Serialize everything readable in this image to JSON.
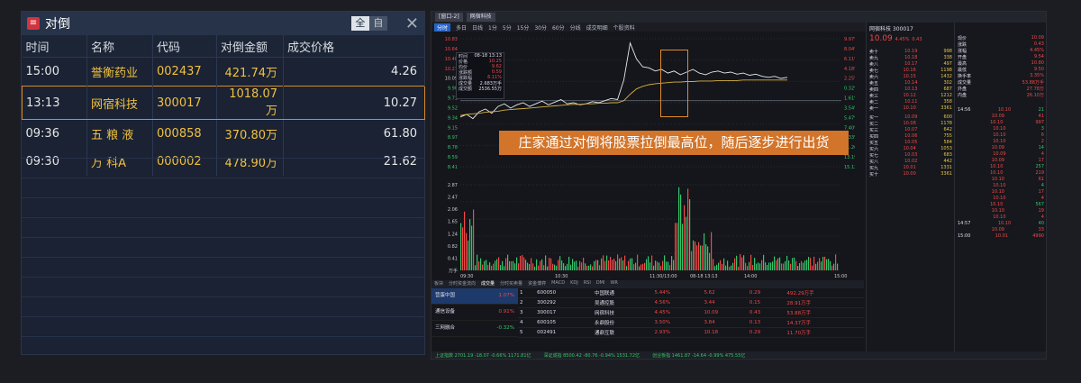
{
  "left_panel": {
    "title": "对倒",
    "logo_glyph": "≡",
    "toggle_all": "全",
    "toggle_self": "自",
    "close_glyph": "✕",
    "columns": [
      "时间",
      "名称",
      "代码",
      "对倒金额",
      "成交价格"
    ],
    "rows": [
      {
        "time": "15:00",
        "name": "誉衡药业",
        "code": "002437",
        "amount": "421.74万",
        "price": "4.26"
      },
      {
        "time": "13:13",
        "name": "网宿科技",
        "code": "300017",
        "amount": "1018.07万",
        "price": "10.27"
      },
      {
        "time": "09:36",
        "name": "五 粮 液",
        "code": "000858",
        "amount": "370.80万",
        "price": "61.80"
      },
      {
        "time": "09:30",
        "name": "万 科A",
        "code": "000002",
        "amount": "478.90万",
        "price": "21.62"
      }
    ],
    "selected_row": 1
  },
  "right_panel": {
    "window_tab": "[窗口-2]",
    "window_tab2": "网宿科技",
    "toolbar": [
      "分时",
      "多日",
      "日线",
      "1分",
      "5分",
      "15分",
      "30分",
      "60分",
      "分线",
      "成交明细",
      "个股资料"
    ],
    "stock_title": "网宿科技 300017",
    "price": "10.09",
    "change": "0.43",
    "change_pct": "4.45%",
    "info_box": {
      "date": "08-18 13:13",
      "lines": [
        "时间",
        "价格",
        "均价",
        "涨跌额",
        "涨跌幅",
        "成交量",
        "成交额"
      ],
      "values": [
        "08-18 13:13",
        "10.25",
        "9.62",
        "0.59",
        "6.11%",
        "2.683万手",
        "2536.55万"
      ]
    },
    "left_axis": [
      "10.83",
      "10.64",
      "10.46",
      "10.27",
      "10.09",
      "9.90",
      "9.71",
      "9.52",
      "9.34",
      "9.15",
      "8.97",
      "8.78",
      "8.59",
      "8.41"
    ],
    "right_axis": [
      "9.97%",
      "8.04%",
      "6.11%",
      "4.18%",
      "2.25%",
      "0.32%",
      "1.61%",
      "3.54%",
      "5.47%",
      "7.40%",
      "9.33%",
      "11.26%",
      "13.19%",
      "15.12%"
    ],
    "price_series": [
      9.35,
      9.4,
      9.32,
      9.45,
      9.5,
      9.42,
      9.55,
      9.6,
      9.52,
      9.58,
      9.62,
      9.55,
      9.6,
      9.65,
      9.58,
      9.63,
      9.68,
      9.6,
      9.62,
      9.58,
      9.6,
      9.64,
      9.62,
      9.66,
      9.7,
      9.68,
      10.05,
      10.75,
      10.45,
      10.3,
      10.28,
      10.22,
      10.25,
      10.18,
      10.22,
      10.15,
      10.2,
      10.25,
      10.18,
      10.15,
      10.2,
      10.22,
      10.18,
      10.2,
      10.16,
      10.18,
      10.14,
      10.16,
      10.12,
      10.1,
      10.12,
      10.08,
      10.1
    ],
    "avg_series": [
      9.38,
      9.4,
      9.41,
      9.42,
      9.44,
      9.45,
      9.46,
      9.48,
      9.49,
      9.5,
      9.51,
      9.52,
      9.53,
      9.54,
      9.55,
      9.56,
      9.57,
      9.58,
      9.59,
      9.59,
      9.6,
      9.6,
      9.61,
      9.61,
      9.62,
      9.62,
      9.66,
      9.78,
      9.88,
      9.93,
      9.96,
      9.98,
      9.99,
      10.0,
      10.01,
      10.01,
      10.02,
      10.02,
      10.03,
      10.03,
      10.03,
      10.04,
      10.04,
      10.04,
      10.04,
      10.05,
      10.05,
      10.05,
      10.05,
      10.05,
      10.05,
      10.05,
      10.05
    ],
    "volume_axis": [
      "2.87",
      "2.47",
      "2.06",
      "1.65",
      "1.24",
      "0.82",
      "0.41",
      "万手"
    ],
    "time_axis": [
      "09:30",
      "10:30",
      "11:30/13:00",
      "08-18 13:13",
      "14:00",
      "15:00"
    ],
    "annotation": "庄家通过对倒将股票拉倒最高位，随后逐步进行出货",
    "bottom_tabs": [
      "板块",
      "分时资金流向",
      "成交量",
      "分时买卖量",
      "资金博弈",
      "MACD",
      "KDJ",
      "RSI",
      "DMI",
      "WR"
    ],
    "bottom_rows": [
      {
        "idx": "1",
        "code": "600050",
        "name": "中国联通",
        "pct": "5.44%",
        "price": "5.62",
        "chg": "0.29",
        "vol": "492.29万手"
      },
      {
        "idx": "2",
        "code": "300292",
        "name": "吴通控股",
        "pct": "4.56%",
        "price": "3.44",
        "chg": "0.15",
        "vol": "28.91万手"
      },
      {
        "idx": "3",
        "code": "300017",
        "name": "网宿科技",
        "pct": "4.45%",
        "price": "10.09",
        "chg": "0.43",
        "vol": "53.88万手"
      },
      {
        "idx": "4",
        "code": "600105",
        "name": "永鼎股份",
        "pct": "3.50%",
        "price": "3.84",
        "chg": "0.13",
        "vol": "14.37万手"
      },
      {
        "idx": "5",
        "code": "002491",
        "name": "通鼎互联",
        "pct": "2.93%",
        "price": "10.18",
        "chg": "0.29",
        "vol": "11.70万手"
      }
    ],
    "sector_list": [
      {
        "name": "营蛋中国",
        "pct": "1.07%"
      },
      {
        "name": "通信设备",
        "pct": "0.91%"
      },
      {
        "name": "三网融合",
        "pct": "-0.32%"
      }
    ],
    "orderbook_asks": [
      [
        "卖十",
        "10.19",
        "998"
      ],
      [
        "卖九",
        "10.18",
        "338"
      ],
      [
        "卖八",
        "10.17",
        "497"
      ],
      [
        "卖七",
        "10.16",
        "1198"
      ],
      [
        "卖六",
        "10.15",
        "1432"
      ],
      [
        "卖五",
        "10.14",
        "302"
      ],
      [
        "卖四",
        "10.13",
        "687"
      ],
      [
        "卖三",
        "10.12",
        "1212"
      ],
      [
        "卖二",
        "10.11",
        "358"
      ],
      [
        "卖一",
        "10.10",
        "3361"
      ]
    ],
    "orderbook_bids": [
      [
        "买一",
        "10.09",
        "600"
      ],
      [
        "买二",
        "10.08",
        "1178"
      ],
      [
        "买三",
        "10.07",
        "642"
      ],
      [
        "买四",
        "10.06",
        "755"
      ],
      [
        "买五",
        "10.05",
        "584"
      ],
      [
        "买六",
        "10.04",
        "1053"
      ],
      [
        "买七",
        "10.03",
        "683"
      ],
      [
        "买八",
        "10.02",
        "442"
      ],
      [
        "买九",
        "10.01",
        "1331"
      ],
      [
        "买十",
        "10.00",
        "3361"
      ]
    ],
    "quote_fields": [
      [
        "现价",
        "10.09"
      ],
      [
        "涨跌",
        "0.43"
      ],
      [
        "涨幅",
        "4.45%"
      ],
      [
        "开盘",
        "9.54"
      ],
      [
        "最高",
        "10.80"
      ],
      [
        "最低",
        "9.50"
      ],
      [
        "换手率",
        "3.35%"
      ],
      [
        "成交量",
        "53.88万手"
      ],
      [
        "外盘",
        "27.78万"
      ],
      [
        "内盘",
        "26.10万"
      ]
    ],
    "ticks": [
      [
        "14:56",
        "10.10",
        "21"
      ],
      [
        "",
        "10.09",
        "41"
      ],
      [
        "",
        "10.10",
        "997"
      ],
      [
        "",
        "10.10",
        "3"
      ],
      [
        "",
        "10.10",
        "6"
      ],
      [
        "",
        "10.10",
        "2"
      ],
      [
        "",
        "10.09",
        "14"
      ],
      [
        "",
        "10.09",
        "4"
      ],
      [
        "",
        "10.09",
        "17"
      ],
      [
        "",
        "10.10",
        "257"
      ],
      [
        "",
        "10.10",
        "219"
      ],
      [
        "",
        "10.10",
        "61"
      ],
      [
        "",
        "10.10",
        "4"
      ],
      [
        "",
        "10.10",
        "17"
      ],
      [
        "",
        "10.10",
        "4"
      ],
      [
        "",
        "10.10",
        "567"
      ],
      [
        "",
        "10.10",
        "19"
      ],
      [
        "",
        "10.10",
        "4"
      ],
      [
        "14:57",
        "10.10",
        "40"
      ],
      [
        "",
        "10.09",
        "33"
      ],
      [
        "15:00",
        "10.01",
        "4990"
      ]
    ],
    "statusbar": [
      "上证指数 2701.19 -18.07 -0.66% 1171.81亿",
      "深证成指 8500.42 -80.76 -0.94% 1531.72亿",
      "创业板指 1461.87 -14.64 -0.99% 475.55亿"
    ]
  },
  "colors": {
    "accent": "#d2742a",
    "up": "#f04848",
    "down": "#36c46a",
    "highlight": "#f0c040"
  }
}
